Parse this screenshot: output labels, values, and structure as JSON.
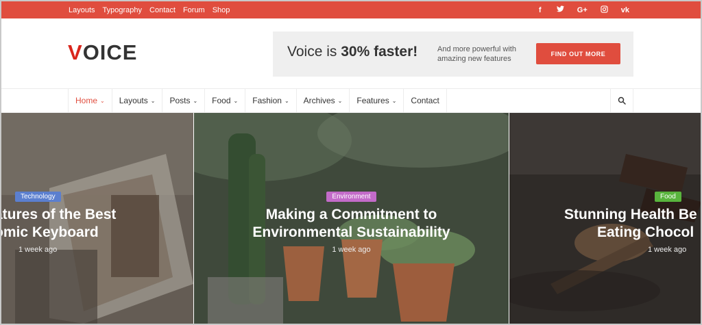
{
  "topbar": {
    "links": [
      "Layouts",
      "Typography",
      "Contact",
      "Forum",
      "Shop"
    ],
    "social_icons": [
      "facebook-icon",
      "twitter-icon",
      "google-plus-icon",
      "instagram-icon",
      "vk-icon"
    ],
    "social_glyphs": [
      "f",
      "✓",
      "G+",
      "◎",
      "vk"
    ],
    "color": "#e04d3e"
  },
  "header": {
    "logo_first": "V",
    "logo_rest": "OICE",
    "banner": {
      "lead": "Voice is ",
      "highlight": "30% faster!",
      "tagline": "And more powerful with amazing new features",
      "cta_label": "FIND OUT MORE"
    }
  },
  "nav": {
    "items": [
      {
        "label": "Home",
        "has_dropdown": true,
        "active": true
      },
      {
        "label": "Layouts",
        "has_dropdown": true
      },
      {
        "label": "Posts",
        "has_dropdown": true
      },
      {
        "label": "Food",
        "has_dropdown": true
      },
      {
        "label": "Fashion",
        "has_dropdown": true
      },
      {
        "label": "Archives",
        "has_dropdown": true
      },
      {
        "label": "Features",
        "has_dropdown": true
      },
      {
        "label": "Contact",
        "has_dropdown": false
      }
    ],
    "search_icon": "search-icon"
  },
  "slides": [
    {
      "category": "Technology",
      "category_color": "#5b7fcf",
      "title_line1": "atures of the Best",
      "title_line2": "omic Keyboard",
      "meta": "1 week ago"
    },
    {
      "category": "Environment",
      "category_color": "#c36bc9",
      "title_line1": "Making a Commitment to",
      "title_line2": "Environmental Sustainability",
      "meta": "1 week ago"
    },
    {
      "category": "Food",
      "category_color": "#59b43d",
      "title_line1": "Stunning Health Be",
      "title_line2": "Eating Chocol",
      "meta": "1 week ago"
    }
  ]
}
